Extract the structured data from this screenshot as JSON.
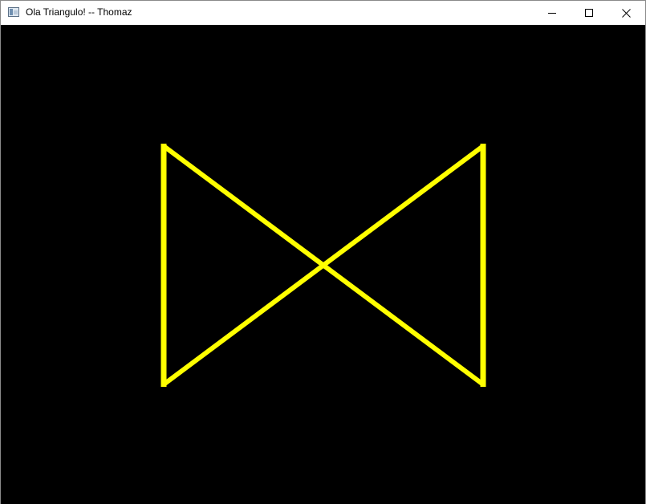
{
  "window": {
    "title": "Ola Triangulo! -- Thomaz",
    "icon": "app-window-icon",
    "controls": [
      "minimize-icon",
      "maximize-icon",
      "close-icon"
    ]
  },
  "canvas": {
    "background_color": "#000000",
    "stroke_color": "#ffff00",
    "shape": "bowtie-outline"
  }
}
